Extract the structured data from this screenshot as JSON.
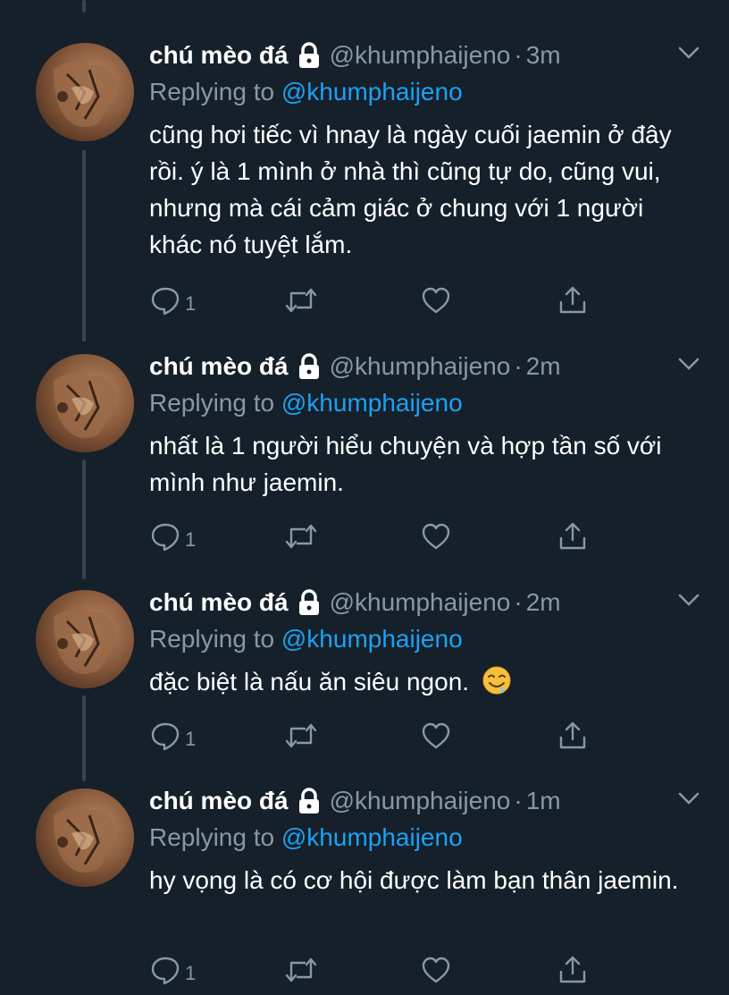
{
  "tweets": [
    {
      "display_name": "chú mèo đá",
      "handle": "@khumphaijeno",
      "time": "3m",
      "replying_prefix": "Replying to",
      "replying_to": "@khumphaijeno",
      "text": "cũng hơi tiếc vì hnay là ngày cuối jaemin ở đây rồi. ý là 1 mình ở nhà thì cũng tự do, cũng vui, nhưng mà cái cảm giác ở chung với 1 người khác nó tuyệt lắm.",
      "reply_count": "1"
    },
    {
      "display_name": "chú mèo đá",
      "handle": "@khumphaijeno",
      "time": "2m",
      "replying_prefix": "Replying to",
      "replying_to": "@khumphaijeno",
      "text": "nhất là 1 người hiểu chuyện và hợp tần số với mình như jaemin.",
      "reply_count": "1"
    },
    {
      "display_name": "chú mèo đá",
      "handle": "@khumphaijeno",
      "time": "2m",
      "replying_prefix": "Replying to",
      "replying_to": "@khumphaijeno",
      "text": "đặc biệt là nấu ăn siêu ngon.",
      "emoji": "drooling-face",
      "reply_count": "1"
    },
    {
      "display_name": "chú mèo đá",
      "handle": "@khumphaijeno",
      "time": "1m",
      "replying_prefix": "Replying to",
      "replying_to": "@khumphaijeno",
      "text": "hy vọng là có cơ hội được làm bạn thân jaemin.",
      "reply_count": "1"
    }
  ],
  "separator": "·",
  "colors": {
    "background": "#15202b",
    "primary_text": "#ffffff",
    "secondary_text": "#8899a6",
    "link": "#1da1f2",
    "thread_line": "#38444d"
  },
  "icons": {
    "lock": "lock-icon",
    "chevron": "chevron-down-icon",
    "reply": "reply-icon",
    "retweet": "retweet-icon",
    "like": "heart-icon",
    "share": "share-icon"
  }
}
